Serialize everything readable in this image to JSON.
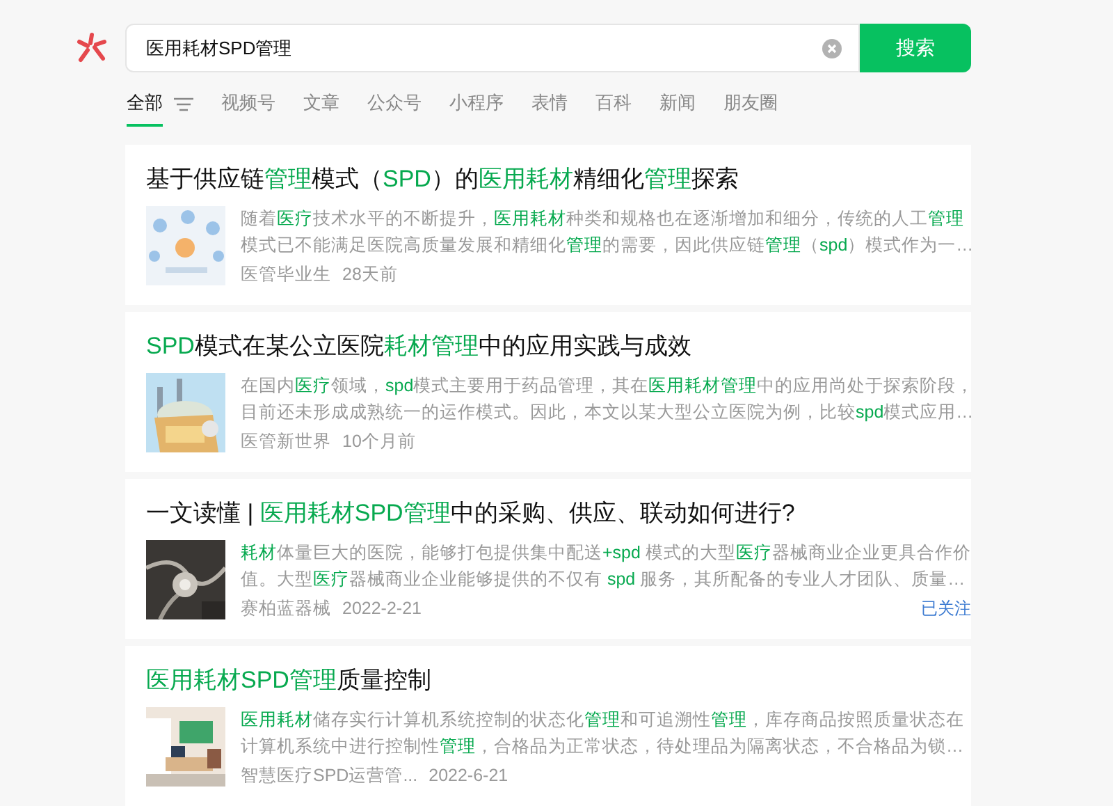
{
  "search": {
    "value": "医用耗材SPD管理",
    "button": "搜索"
  },
  "tabs": [
    {
      "label": "全部",
      "selected": true
    },
    {
      "label": "视频号",
      "selected": false
    },
    {
      "label": "文章",
      "selected": false
    },
    {
      "label": "公众号",
      "selected": false
    },
    {
      "label": "小程序",
      "selected": false
    },
    {
      "label": "表情",
      "selected": false
    },
    {
      "label": "百科",
      "selected": false
    },
    {
      "label": "新闻",
      "selected": false
    },
    {
      "label": "朋友圈",
      "selected": false
    }
  ],
  "results": [
    {
      "title": [
        {
          "text": "基于供应链",
          "highlight": false
        },
        {
          "text": "管理",
          "highlight": true
        },
        {
          "text": "模式（",
          "highlight": false
        },
        {
          "text": "SPD",
          "highlight": true
        },
        {
          "text": "）的",
          "highlight": false
        },
        {
          "text": "医用耗材",
          "highlight": true
        },
        {
          "text": "精细化",
          "highlight": false
        },
        {
          "text": "管理",
          "highlight": true
        },
        {
          "text": "探索",
          "highlight": false
        }
      ],
      "thumbnail": {
        "kind": "picture"
      },
      "description": [
        [
          {
            "text": "随着",
            "highlight": false
          },
          {
            "text": "医疗",
            "highlight": true
          },
          {
            "text": "技术水平的不断提升，",
            "highlight": false
          },
          {
            "text": "医用耗材",
            "highlight": true
          },
          {
            "text": "种类和规格也在逐渐增加和细分，传统的人工",
            "highlight": false
          },
          {
            "text": "管理",
            "highlight": true
          }
        ],
        [
          {
            "text": "模式已不能满足医院高质量发展和精细化",
            "highlight": false
          },
          {
            "text": "管理",
            "highlight": true
          },
          {
            "text": "的需要，因此供应链",
            "highlight": false
          },
          {
            "text": "管理",
            "highlight": true
          },
          {
            "text": "（",
            "highlight": false
          },
          {
            "text": "spd",
            "highlight": true
          },
          {
            "text": "）模式作为一…",
            "highlight": false
          }
        ]
      ],
      "source": "医管毕业生",
      "date": "28天前"
    },
    {
      "title": [
        {
          "text": "SPD",
          "highlight": true
        },
        {
          "text": "模式在某公立医院",
          "highlight": false
        },
        {
          "text": "耗材管理",
          "highlight": true
        },
        {
          "text": "中的应用实践与成效",
          "highlight": false
        }
      ],
      "thumbnail": {
        "kind": "picture"
      },
      "description": [
        [
          {
            "text": "在国内",
            "highlight": false
          },
          {
            "text": "医疗",
            "highlight": true
          },
          {
            "text": "领域，",
            "highlight": false
          },
          {
            "text": "spd",
            "highlight": true
          },
          {
            "text": "模式主要用于药品管理，其在",
            "highlight": false
          },
          {
            "text": "医用耗材管理",
            "highlight": true
          },
          {
            "text": "中的应用尚处于探索阶段，",
            "highlight": false
          }
        ],
        [
          {
            "text": "目前还未形成成熟统一的运作模式。因此，本文以某大型公立医院为例，比较",
            "highlight": false
          },
          {
            "text": "spd",
            "highlight": true
          },
          {
            "text": "模式应用…",
            "highlight": false
          }
        ]
      ],
      "source": "医管新世界",
      "date": "10个月前"
    },
    {
      "title": [
        {
          "text": "一文读懂 | ",
          "highlight": false
        },
        {
          "text": "医用耗材SPD管理",
          "highlight": true
        },
        {
          "text": "中的采购、供应、联动如何进行?",
          "highlight": false
        }
      ],
      "thumbnail": {
        "kind": "picture"
      },
      "description": [
        [
          {
            "text": "耗材",
            "highlight": true
          },
          {
            "text": "体量巨大的医院，能够打包提供集中配送",
            "highlight": false
          },
          {
            "text": "+spd",
            "highlight": true
          },
          {
            "text": " 模式的大型",
            "highlight": false
          },
          {
            "text": "医疗",
            "highlight": true
          },
          {
            "text": "器械商业企业更具合作价",
            "highlight": false
          }
        ],
        [
          {
            "text": "值。大型",
            "highlight": false
          },
          {
            "text": "医疗",
            "highlight": true
          },
          {
            "text": "器械商业企业能够提供的不仅有 ",
            "highlight": false
          },
          {
            "text": "spd",
            "highlight": true
          },
          {
            "text": " 服务，其所配备的专业人才团队、质量…",
            "highlight": false
          }
        ]
      ],
      "source": "赛柏蓝器械",
      "date": "2022-2-21",
      "follow": "已关注"
    },
    {
      "title": [
        {
          "text": "医用耗材SPD管理",
          "highlight": true
        },
        {
          "text": "质量控制",
          "highlight": false
        }
      ],
      "thumbnail": {
        "kind": "picture"
      },
      "description": [
        [
          {
            "text": "医用耗材",
            "highlight": true
          },
          {
            "text": "储存实行计算机系统控制的状态化",
            "highlight": false
          },
          {
            "text": "管理",
            "highlight": true
          },
          {
            "text": "和可追溯性",
            "highlight": false
          },
          {
            "text": "管理",
            "highlight": true
          },
          {
            "text": "，库存商品按照质量状态在",
            "highlight": false
          }
        ],
        [
          {
            "text": "计算机系统中进行控制性",
            "highlight": false
          },
          {
            "text": "管理",
            "highlight": true
          },
          {
            "text": "，合格品为正常状态，待处理品为隔离状态，不合格品为锁…",
            "highlight": false
          }
        ]
      ],
      "source": "智慧医疗SPD运营管...",
      "date": "2022-6-21"
    }
  ]
}
